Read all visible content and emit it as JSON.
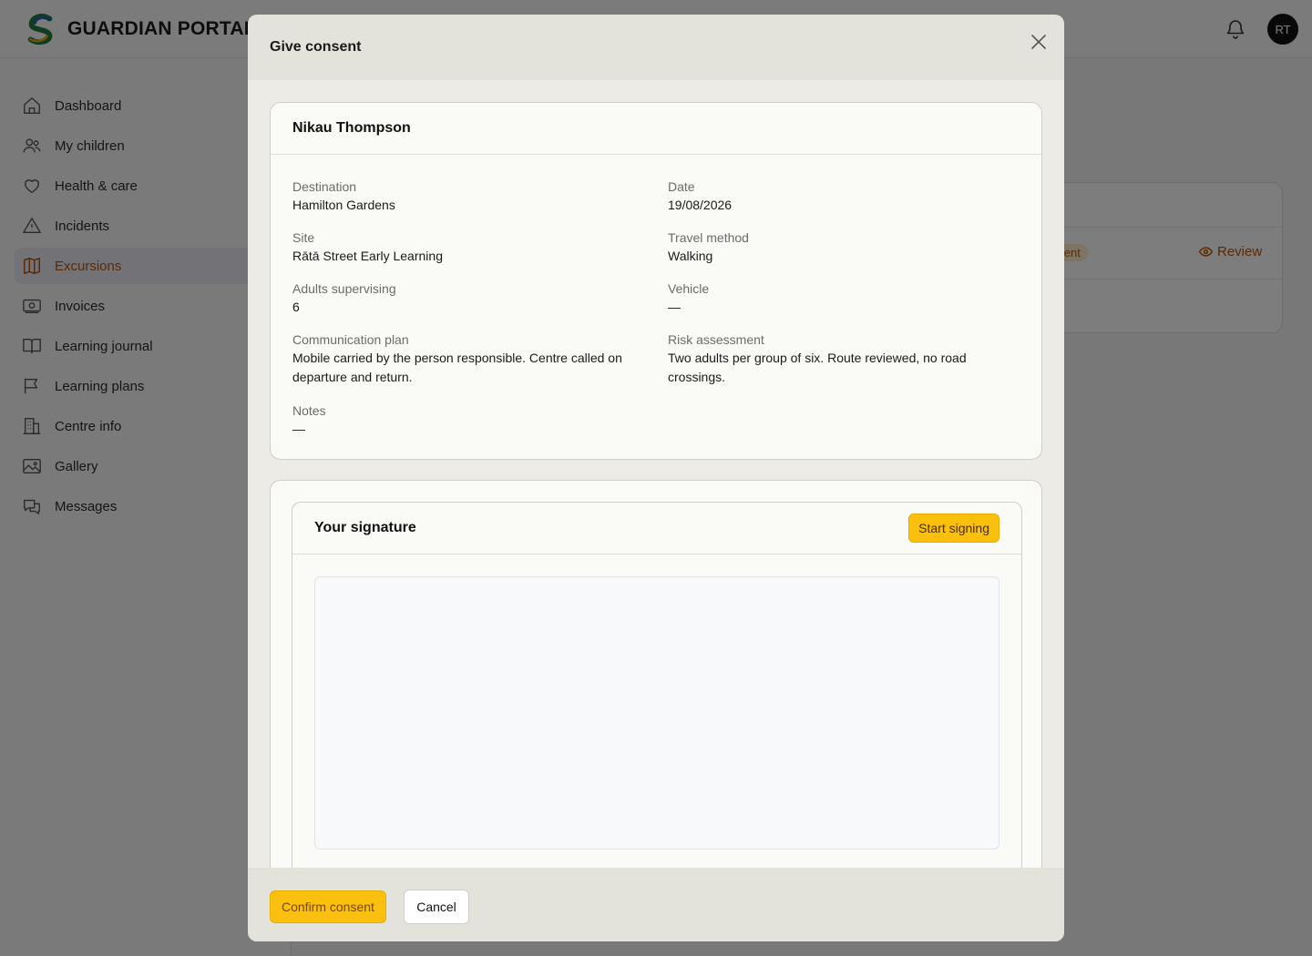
{
  "app": {
    "name": "GUARDIAN PORTAL",
    "user_initials": "RT"
  },
  "sidebar": {
    "items": [
      {
        "label": "Dashboard",
        "icon": "home-icon"
      },
      {
        "label": "My children",
        "icon": "users-icon"
      },
      {
        "label": "Health & care",
        "icon": "heart-icon"
      },
      {
        "label": "Incidents",
        "icon": "warning-icon"
      },
      {
        "label": "Excursions",
        "icon": "map-icon",
        "active": true
      },
      {
        "label": "Invoices",
        "icon": "banknote-icon"
      },
      {
        "label": "Learning journal",
        "icon": "book-icon"
      },
      {
        "label": "Learning plans",
        "icon": "flag-icon"
      },
      {
        "label": "Centre info",
        "icon": "building-icon"
      },
      {
        "label": "Gallery",
        "icon": "image-icon"
      },
      {
        "label": "Messages",
        "icon": "chat-icon"
      }
    ]
  },
  "background": {
    "badge_fragment": "nsent",
    "review_label": "Review"
  },
  "modal": {
    "title": "Give consent",
    "child_name": "Nikau Thompson",
    "fields": {
      "destination": {
        "label": "Destination",
        "value": "Hamilton Gardens"
      },
      "date": {
        "label": "Date",
        "value": "19/08/2026"
      },
      "site": {
        "label": "Site",
        "value": "Rātā Street Early Learning"
      },
      "travel_method": {
        "label": "Travel method",
        "value": "Walking"
      },
      "adults_supervising": {
        "label": "Adults supervising",
        "value": "6"
      },
      "vehicle": {
        "label": "Vehicle",
        "value": "—"
      },
      "communication_plan": {
        "label": "Communication plan",
        "value": "Mobile carried by the person responsible. Centre called on departure and return."
      },
      "risk_assessment": {
        "label": "Risk assessment",
        "value": "Two adults per group of six. Route reviewed, no road crossings."
      },
      "notes": {
        "label": "Notes",
        "value": "—"
      }
    },
    "signature": {
      "title": "Your signature",
      "start_label": "Start signing"
    },
    "footer": {
      "confirm_label": "Confirm consent",
      "cancel_label": "Cancel"
    }
  },
  "colors": {
    "accent": "#fbbf0e",
    "active_nav_text": "#b45309"
  }
}
